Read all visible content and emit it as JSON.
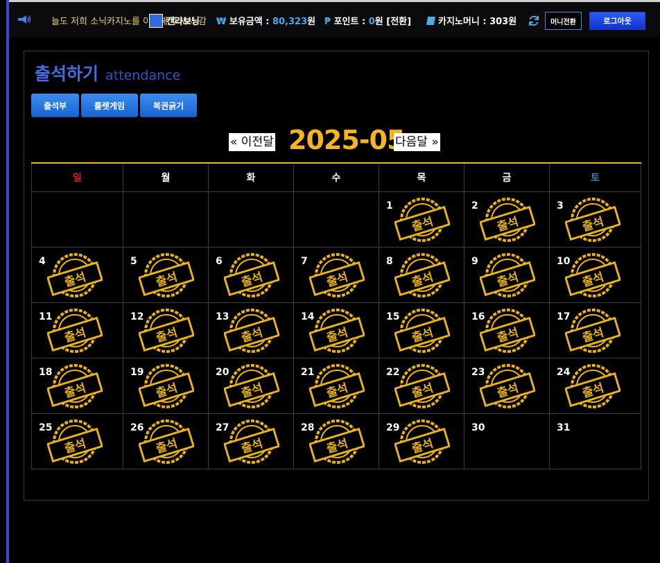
{
  "topbar": {
    "marquee": "늘도 저희 소닉카지노를 이용해 주셔서 감",
    "nickname": "캔라보닝",
    "balance_label": "보유금액 : ",
    "balance_value": "80,323",
    "balance_unit": "원",
    "point_symbol": "₱",
    "point_label": "포인트 : ",
    "point_value": "0",
    "point_suffix": "원 [전환]",
    "casino_label": "카지노머니 : ",
    "casino_value": "303원",
    "money_convert": "머니전환",
    "logout": "로그아웃"
  },
  "page": {
    "title_ko": "출석하기",
    "title_en": "attendance",
    "tabs": [
      {
        "label": "출석부"
      },
      {
        "label": "룰렛게임"
      },
      {
        "label": "복권긁기"
      }
    ],
    "prev_month": "« 이전달",
    "current_month": "2025-05",
    "next_month": "다음달 »"
  },
  "calendar": {
    "weekdays": [
      "일",
      "월",
      "화",
      "수",
      "목",
      "금",
      "토"
    ],
    "stamp_text": "출석",
    "stamp_color": "#e8b21c",
    "days": [
      {
        "day": "1",
        "attended": true
      },
      {
        "day": "2",
        "attended": true
      },
      {
        "day": "3",
        "attended": true
      },
      {
        "day": "4",
        "attended": true
      },
      {
        "day": "5",
        "attended": true
      },
      {
        "day": "6",
        "attended": true
      },
      {
        "day": "7",
        "attended": true
      },
      {
        "day": "8",
        "attended": true
      },
      {
        "day": "9",
        "attended": true
      },
      {
        "day": "10",
        "attended": true
      },
      {
        "day": "11",
        "attended": true
      },
      {
        "day": "12",
        "attended": true
      },
      {
        "day": "13",
        "attended": true
      },
      {
        "day": "14",
        "attended": true
      },
      {
        "day": "15",
        "attended": true
      },
      {
        "day": "16",
        "attended": true
      },
      {
        "day": "17",
        "attended": true
      },
      {
        "day": "18",
        "attended": true
      },
      {
        "day": "19",
        "attended": true
      },
      {
        "day": "20",
        "attended": true
      },
      {
        "day": "21",
        "attended": true
      },
      {
        "day": "22",
        "attended": true
      },
      {
        "day": "23",
        "attended": true
      },
      {
        "day": "24",
        "attended": true
      },
      {
        "day": "25",
        "attended": true
      },
      {
        "day": "26",
        "attended": true
      },
      {
        "day": "27",
        "attended": true
      },
      {
        "day": "28",
        "attended": true
      },
      {
        "day": "29",
        "attended": true
      },
      {
        "day": "30",
        "attended": false
      },
      {
        "day": "31",
        "attended": false
      }
    ]
  }
}
